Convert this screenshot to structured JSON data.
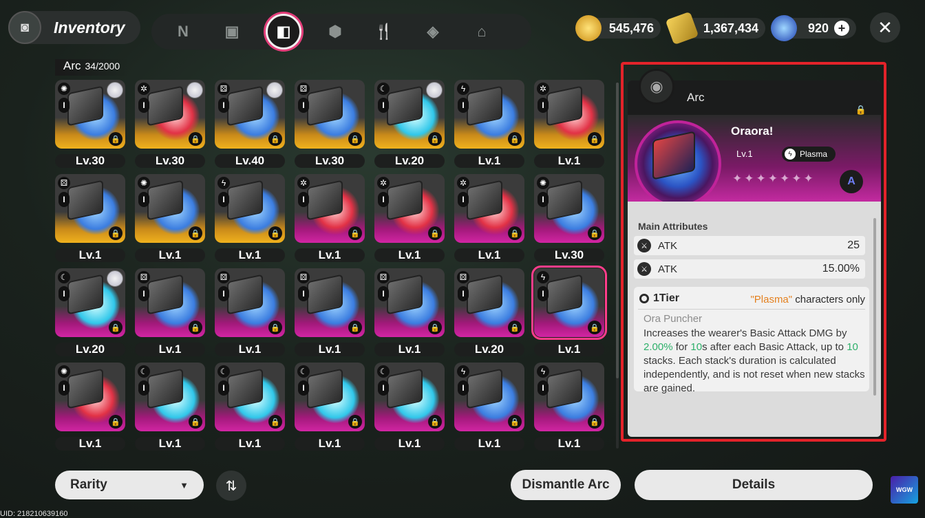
{
  "header": {
    "title": "Inventory",
    "tabs": [
      {
        "icon": "n-logo-icon"
      },
      {
        "icon": "device-icon"
      },
      {
        "icon": "arc-case-icon",
        "active": true
      },
      {
        "icon": "cube-icon"
      },
      {
        "icon": "fork-knife-icon"
      },
      {
        "icon": "crystal-icon"
      },
      {
        "icon": "house-icon"
      }
    ],
    "currencies": [
      {
        "icon": "gold-coin-icon",
        "value": "545,476"
      },
      {
        "icon": "ticket-icon",
        "value": "1,367,434"
      },
      {
        "icon": "blue-gem-icon",
        "value": "920"
      }
    ]
  },
  "arc_list": {
    "label": "Arc",
    "count": "34/2000"
  },
  "cards": [
    {
      "rarity": "gold",
      "disc": "blue",
      "elem": "swirl",
      "lvl": "Lv.30",
      "avatar": true
    },
    {
      "rarity": "gold",
      "disc": "red",
      "elem": "gear",
      "lvl": "Lv.30",
      "avatar": true
    },
    {
      "rarity": "gold",
      "disc": "blue",
      "elem": "dice",
      "lvl": "Lv.40",
      "avatar": true
    },
    {
      "rarity": "gold",
      "disc": "blue",
      "elem": "dice",
      "lvl": "Lv.30",
      "avatar": false
    },
    {
      "rarity": "gold",
      "disc": "cyan",
      "elem": "moon",
      "lvl": "Lv.20",
      "avatar": true
    },
    {
      "rarity": "gold",
      "disc": "blue",
      "elem": "bolt",
      "lvl": "Lv.1",
      "avatar": false
    },
    {
      "rarity": "gold",
      "disc": "red",
      "elem": "gear",
      "lvl": "Lv.1",
      "avatar": false
    },
    {
      "rarity": "gold",
      "disc": "blue",
      "elem": "dice",
      "lvl": "Lv.1",
      "avatar": false
    },
    {
      "rarity": "gold",
      "disc": "blue",
      "elem": "swirl",
      "lvl": "Lv.1",
      "avatar": false
    },
    {
      "rarity": "gold",
      "disc": "blue",
      "elem": "bolt",
      "lvl": "Lv.1",
      "avatar": false
    },
    {
      "rarity": "pink",
      "disc": "red",
      "elem": "gear",
      "lvl": "Lv.1",
      "avatar": false
    },
    {
      "rarity": "pink",
      "disc": "red",
      "elem": "gear",
      "lvl": "Lv.1",
      "avatar": false
    },
    {
      "rarity": "pink",
      "disc": "red",
      "elem": "gear",
      "lvl": "Lv.1",
      "avatar": false
    },
    {
      "rarity": "pink",
      "disc": "blue",
      "elem": "swirl",
      "lvl": "Lv.30",
      "avatar": false
    },
    {
      "rarity": "pink",
      "disc": "cyan",
      "elem": "moon",
      "lvl": "Lv.20",
      "avatar": true
    },
    {
      "rarity": "pink",
      "disc": "blue",
      "elem": "dice",
      "lvl": "Lv.1",
      "avatar": false
    },
    {
      "rarity": "pink",
      "disc": "blue",
      "elem": "dice",
      "lvl": "Lv.1",
      "avatar": false
    },
    {
      "rarity": "pink",
      "disc": "blue",
      "elem": "dice",
      "lvl": "Lv.1",
      "avatar": false
    },
    {
      "rarity": "pink",
      "disc": "blue",
      "elem": "dice",
      "lvl": "Lv.1",
      "avatar": false
    },
    {
      "rarity": "pink",
      "disc": "blue",
      "elem": "dice",
      "lvl": "Lv.20",
      "avatar": false
    },
    {
      "rarity": "pink",
      "disc": "blue",
      "elem": "bolt",
      "lvl": "Lv.1",
      "avatar": false,
      "selected": true
    },
    {
      "rarity": "pink",
      "disc": "red",
      "elem": "swirl",
      "lvl": "Lv.1",
      "avatar": false
    },
    {
      "rarity": "pink",
      "disc": "cyan",
      "elem": "moon",
      "lvl": "Lv.1",
      "avatar": false
    },
    {
      "rarity": "pink",
      "disc": "cyan",
      "elem": "moon",
      "lvl": "Lv.1",
      "avatar": false
    },
    {
      "rarity": "pink",
      "disc": "cyan",
      "elem": "moon",
      "lvl": "Lv.1",
      "avatar": false
    },
    {
      "rarity": "pink",
      "disc": "cyan",
      "elem": "moon",
      "lvl": "Lv.1",
      "avatar": false
    },
    {
      "rarity": "pink",
      "disc": "blue",
      "elem": "bolt",
      "lvl": "Lv.1",
      "avatar": false
    },
    {
      "rarity": "pink",
      "disc": "blue",
      "elem": "bolt",
      "lvl": "Lv.1",
      "avatar": false
    }
  ],
  "detail": {
    "section": "Arc",
    "name": "Oraora!",
    "level": "Lv.1",
    "attribute": "Plasma",
    "stars": "✦✦✦✦✦✦✦",
    "brand_icon": "A",
    "main_attributes_label": "Main Attributes",
    "attributes": [
      {
        "name": "ATK",
        "value": "25"
      },
      {
        "name": "ATK",
        "value": "15.00%"
      }
    ],
    "tier": "1Tier",
    "condition_highlight": "\"Plasma\"",
    "condition_suffix": " characters only",
    "skill_name": "Ora Puncher",
    "desc_1": "Increases the wearer's Basic Attack DMG by ",
    "desc_val_1": "2.00%",
    "desc_2": " for ",
    "desc_val_2": "10",
    "desc_3": "s after each Basic Attack, up to ",
    "desc_val_3": "10",
    "desc_4": " stacks. Each stack's duration is calculated independently, and is not reset when new stacks are gained."
  },
  "footer": {
    "rarity_label": "Rarity",
    "dismantle_label": "Dismantle Arc",
    "details_label": "Details",
    "uid": "UID: 218210639160",
    "channel_logo": "WGW"
  },
  "colors": {
    "accent_pink": "#e33e7a",
    "highlight_red": "#e3232a",
    "gold": "#f0b21d",
    "purple": "#d225a4",
    "plasma_text": "#e4801e",
    "value_green": "#2eb06a"
  }
}
